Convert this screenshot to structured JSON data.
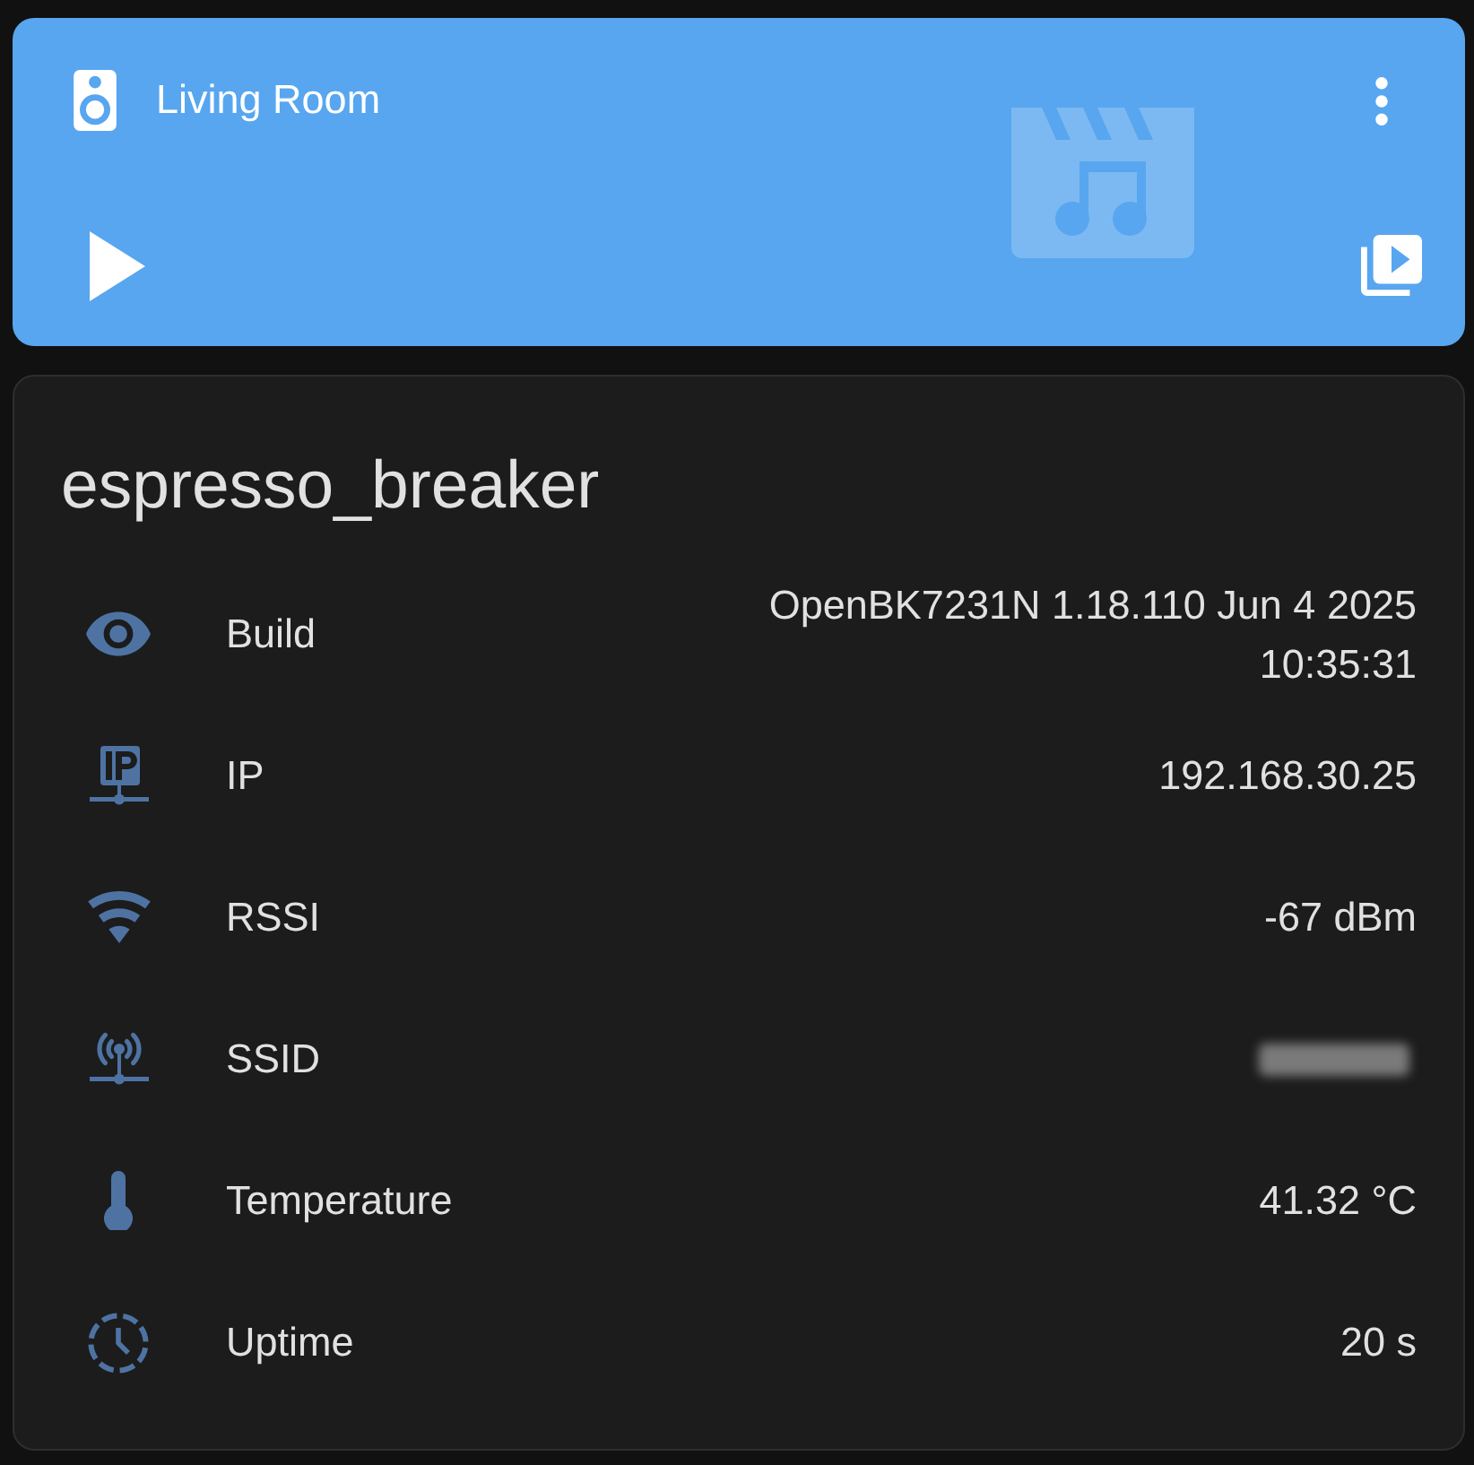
{
  "media_card": {
    "name": "Living Room",
    "playing": false
  },
  "device_card": {
    "title": "espresso_breaker",
    "rows": [
      {
        "label": "Build",
        "value": "OpenBK7231N 1.18.110 Jun 4 2025 10:35:31",
        "redacted": false
      },
      {
        "label": "IP",
        "value": "192.168.30.25",
        "redacted": false
      },
      {
        "label": "RSSI",
        "value": "-67 dBm",
        "redacted": false
      },
      {
        "label": "SSID",
        "redacted": true
      },
      {
        "label": "Temperature",
        "value": "41.32 °C",
        "redacted": false
      },
      {
        "label": "Uptime",
        "value": "20 s",
        "redacted": false
      }
    ]
  }
}
